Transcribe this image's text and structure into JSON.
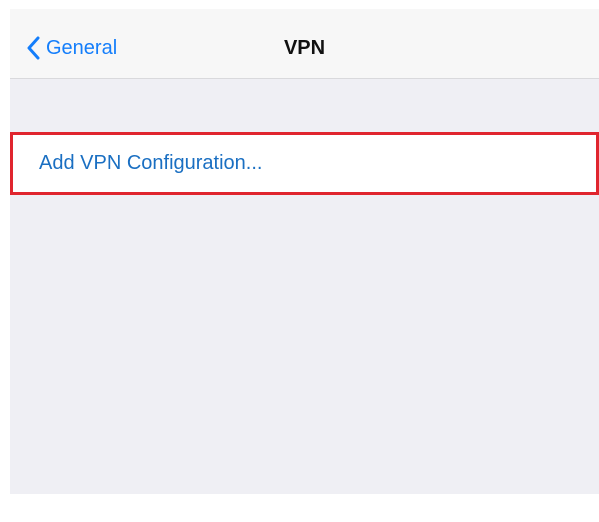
{
  "nav": {
    "back_label": "General",
    "title": "VPN",
    "back_icon": "chevron-left-icon"
  },
  "vpn": {
    "add_configuration_label": "Add VPN Configuration..."
  },
  "colors": {
    "accent": "#147efb",
    "row_text": "#1a6fc2",
    "highlight_border": "#e0252e",
    "background": "#efeff4"
  }
}
